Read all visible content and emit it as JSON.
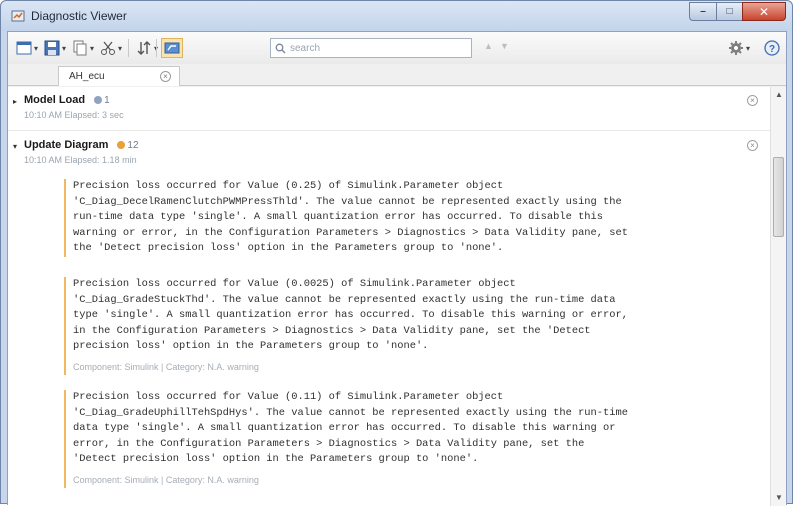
{
  "window": {
    "title": "Diagnostic Viewer",
    "minimize_glyph": "–",
    "maximize_glyph": "□",
    "close_glyph": "✕"
  },
  "toolbar": {
    "search_placeholder": "search",
    "prev_glyph": "▲",
    "next_glyph": "▼",
    "settings_arrow": "▾",
    "help_icon": "help-icon",
    "accent": "#f0b860"
  },
  "tab": {
    "label": "AH_ecu",
    "close_glyph": "×"
  },
  "groups": [
    {
      "title": "Model Load",
      "count": "1",
      "count_color": "#8fa3bf",
      "time": "10:10 AM   Elapsed: 3 sec",
      "expanded": false
    },
    {
      "title": "Update Diagram",
      "count": "12",
      "count_color": "#e6a13a",
      "time": "10:10 AM   Elapsed: 1.18 min",
      "expanded": true
    }
  ],
  "messages": [
    {
      "lines": [
        "Precision loss occurred for Value (0.25) of Simulink.Parameter object",
        "'C_Diag_DecelRamenClutchPWMPressThld'. The value cannot be represented exactly using the",
        "run-time data type 'single'. A small quantization error has occurred. To disable this",
        "warning or error, in the Configuration Parameters > Diagnostics > Data Validity pane, set",
        "the 'Detect precision loss' option in the Parameters group to 'none'."
      ],
      "meta": ""
    },
    {
      "lines": [
        "Precision loss occurred for Value (0.0025) of Simulink.Parameter object",
        "'C_Diag_GradeStuckThd'. The value cannot be represented exactly using the run-time data",
        "type 'single'. A small quantization error has occurred. To disable this warning or error,",
        "in the Configuration Parameters > Diagnostics > Data Validity pane, set the 'Detect",
        "precision loss' option in the Parameters group to 'none'."
      ],
      "meta": "Component: Simulink | Category: N.A. warning"
    },
    {
      "lines": [
        "Precision loss occurred for Value (0.11) of Simulink.Parameter object",
        "'C_Diag_GradeUphillTehSpdHys'. The value cannot be represented exactly using the run-time",
        "data type 'single'. A small quantization error has occurred. To disable this warning or",
        "error, in the Configuration Parameters > Diagnostics > Data Validity pane, set the",
        "'Detect precision loss' option in the Parameters group to 'none'."
      ],
      "meta": "Component: Simulink | Category: N.A. warning"
    }
  ]
}
